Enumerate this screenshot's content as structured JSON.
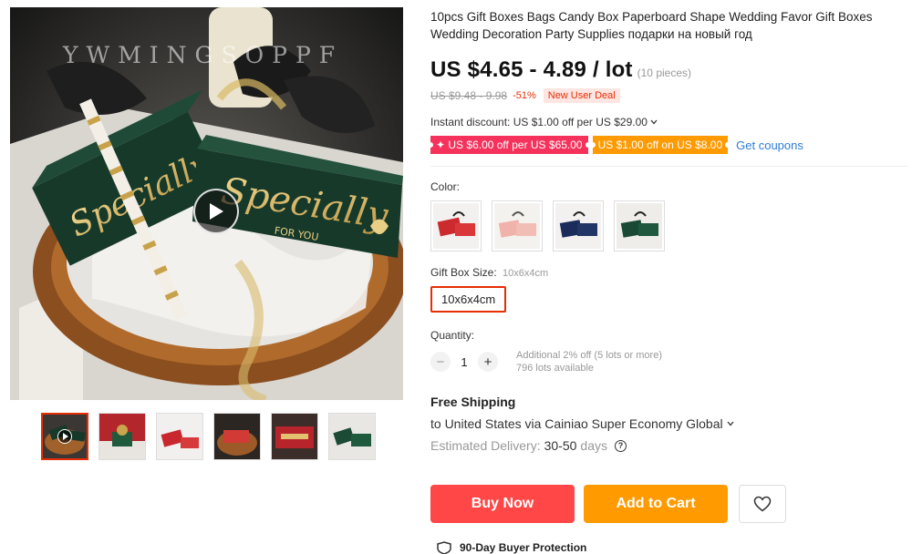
{
  "gallery": {
    "watermark": "YWMINGSOPPF",
    "box_text_main": "Specially",
    "box_text_sub": "FOR YOU",
    "thumbnail_count": 6
  },
  "product": {
    "title": "10pcs Gift Boxes Bags Candy Box Paperboard Shape Wedding Favor Gift Boxes Wedding Decoration Party Supplies подарки на новый год",
    "price": "US $4.65 - 4.89 / lot",
    "pieces": "(10 pieces)",
    "old_price": "US $9.48 - 9.98",
    "discount": "-51%",
    "new_user_deal": "New User Deal",
    "instant_discount": "Instant discount: US $1.00 off per US $29.00",
    "coupons": [
      "✦ US $6.00 off per US $65.00",
      "US $1.00 off on US $8.00"
    ],
    "get_coupons": "Get coupons"
  },
  "options": {
    "color_label": "Color:",
    "colors": [
      "red",
      "pink",
      "navy",
      "green"
    ],
    "size_label": "Gift Box Size:",
    "size_selected": "10x6x4cm",
    "size_option": "10x6x4cm"
  },
  "quantity": {
    "label": "Quantity:",
    "value": "1",
    "minus": "−",
    "plus": "+",
    "note_line1": "Additional 2% off (5 lots or more)",
    "note_line2": "796 lots available"
  },
  "shipping": {
    "title": "Free Shipping",
    "line": "to United States via Cainiao Super Economy Global",
    "est_label": "Estimated Delivery:",
    "est_value": "30-50",
    "est_unit": "days",
    "help": "?"
  },
  "actions": {
    "buy_now": "Buy Now",
    "add_to_cart": "Add to Cart"
  },
  "protection": "90-Day Buyer Protection",
  "colors": {
    "accent": "#ff4747",
    "cart": "#ff9a00",
    "link": "#2e7dd4",
    "box_green": "#16392a",
    "gold": "#e7c97a"
  }
}
